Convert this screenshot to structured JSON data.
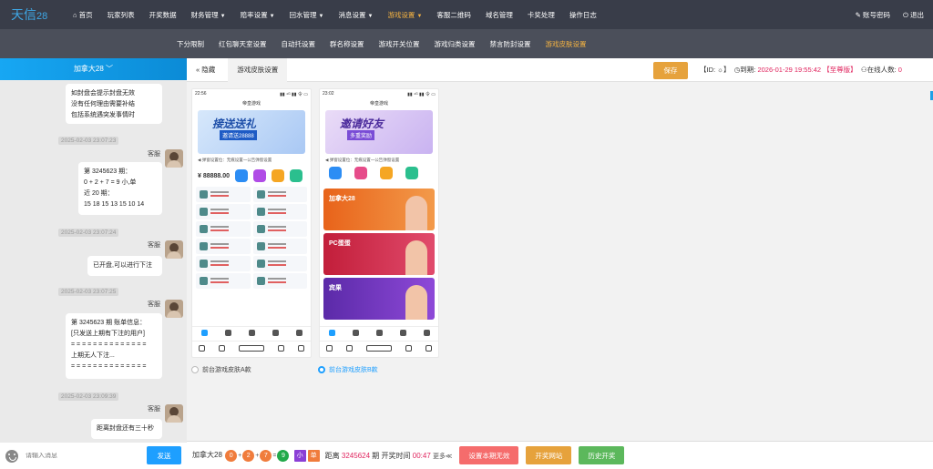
{
  "app": {
    "logo": "天信",
    "logo_num": "28"
  },
  "nav": [
    {
      "label": "首页",
      "caret": false,
      "active": false
    },
    {
      "label": "玩家列表",
      "caret": false,
      "active": false
    },
    {
      "label": "开奖数据",
      "caret": false,
      "active": false
    },
    {
      "label": "财务管理",
      "caret": true,
      "active": false
    },
    {
      "label": "赔率设置",
      "caret": true,
      "active": false
    },
    {
      "label": "回水管理",
      "caret": true,
      "active": false
    },
    {
      "label": "消息设置",
      "caret": true,
      "active": false
    },
    {
      "label": "游戏设置",
      "caret": true,
      "active": true
    },
    {
      "label": "客服二维码",
      "caret": false,
      "active": false
    },
    {
      "label": "域名管理",
      "caret": false,
      "active": false
    },
    {
      "label": "卡奖处理",
      "caret": false,
      "active": false
    },
    {
      "label": "操作日志",
      "caret": false,
      "active": false
    }
  ],
  "top_right": {
    "account": "账号密码",
    "logout": "退出"
  },
  "subnav": [
    {
      "label": "下分限制",
      "active": false
    },
    {
      "label": "红包聊天室设置",
      "active": false
    },
    {
      "label": "自动托设置",
      "active": false
    },
    {
      "label": "群名称设置",
      "active": false
    },
    {
      "label": "游戏开关位置",
      "active": false
    },
    {
      "label": "游戏归类设置",
      "active": false
    },
    {
      "label": "禁言防封设置",
      "active": false
    },
    {
      "label": "游戏皮肤设置",
      "active": true
    }
  ],
  "chat": {
    "room": "加拿大28 ﹀",
    "msg0": [
      "如封盘会提示封盘无效",
      "没有任何理由需要补结",
      "包括系统遇突发事情时"
    ],
    "ts1": "2025-02-03 23:07:23",
    "sender": "客服",
    "msg1": [
      "第 3245623 期：",
      "0 + 2 + 7 = 9 小,单",
      "近 20 期：",
      "15 18 15 13 15 10 14"
    ],
    "ts2": "2025-02-03 23:07:24",
    "msg2": "已开盘,可以进行下注",
    "ts3": "2025-02-03 23:07:25",
    "msg3": [
      "第 3245623 期 账单信息：",
      "[只发送上期有下注的用户]",
      "= = = = = = = = = = = = = =",
      "上期无人下注...",
      "= = = = = = = = = = = = = ="
    ],
    "ts4": "2025-02-03 23:09:39",
    "msg4": "距离封盘还有三十秒",
    "placeholder": "请输入消息",
    "send": "发送"
  },
  "toolbar": {
    "hide": "« 隐藏",
    "tab": "游戏皮肤设置",
    "save": "保存",
    "id": "【ID: ☼】",
    "expire_label": "◷到期: ",
    "expire": "2026-01-29 19:55:42",
    "edition": "【至尊版】",
    "online_label": "⚇在线人数: ",
    "online": "0"
  },
  "skins": {
    "a": {
      "time": "22:56",
      "signal": "▮▮ ⁴ᴳ ▮▮ 令 ▭",
      "title": "帝皇游戏",
      "banner_main": "接送送礼",
      "banner_sub": "邀请送28888",
      "notice": "◀ 弹窗设置位：无痕设置一公告弹窗设置",
      "money": "¥ 88888.00",
      "label": "前台游戏皮肤A款"
    },
    "b": {
      "time": "23:02",
      "signal": "▮▮ ⁴ᴳ ▮▮ 令 ▭",
      "title": "帝皇游戏",
      "banner_main": "邀请好友",
      "banner_sub": "多重奖励",
      "notice": "◀ 弹窗设置位：无痕设置一公告弹窗设置",
      "cards": [
        "加拿大28",
        "PC蛋蛋",
        "宾果"
      ],
      "label": "前台游戏皮肤B款"
    }
  },
  "bottom": {
    "game": "加拿大28",
    "n1": "0",
    "plus1": "+",
    "n2": "2",
    "plus2": "+",
    "n3": "7",
    "eq": "=",
    "sum": "9",
    "size": "小",
    "parity": "单",
    "dist_label": "距离",
    "period": "3245624",
    "period_label": "期 开奖时间",
    "countdown": "00:47",
    "more": "更多≪",
    "btn_void": "设置本期无效",
    "btn_site": "开奖网站",
    "btn_history": "历史开奖"
  },
  "colors": {
    "accent": "#1e9fff",
    "nav_bg": "#393d49",
    "active": "#f5b342",
    "save": "#e6a23c",
    "red": "#e0245e"
  }
}
